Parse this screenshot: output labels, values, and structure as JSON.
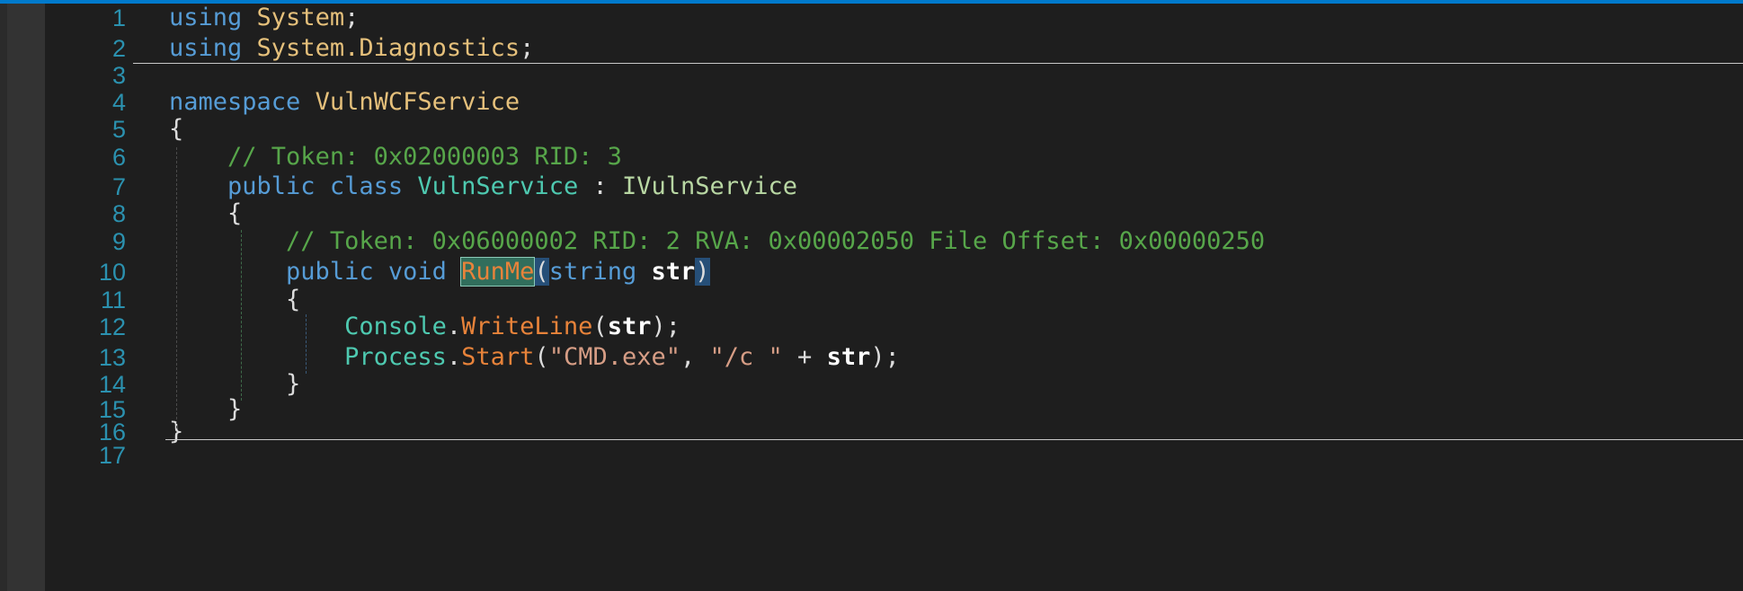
{
  "editor": {
    "colors": {
      "accent_bar": "#007acc",
      "background": "#1e1e1e",
      "line_number": "#2b91af",
      "keyword": "#569cd6",
      "namespace": "#e5c07b",
      "class": "#4ec9b0",
      "interface": "#b8d7a3",
      "comment": "#57a64a",
      "method": "#e8833a",
      "string": "#d69d85"
    },
    "lines": [
      {
        "n": "1",
        "t": [
          "using",
          "System",
          ";"
        ]
      },
      {
        "n": "2",
        "t": [
          "using",
          "System.Diagnostics",
          ";"
        ]
      },
      {
        "n": "3",
        "t": []
      },
      {
        "n": "4",
        "t": [
          "namespace",
          "VulnWCFService"
        ]
      },
      {
        "n": "5",
        "t": [
          "{"
        ]
      },
      {
        "n": "6",
        "t": [
          "// Token: 0x02000003 RID: 3"
        ]
      },
      {
        "n": "7",
        "t": [
          "public",
          "class",
          "VulnService",
          " : ",
          "IVulnService"
        ]
      },
      {
        "n": "8",
        "t": [
          "{"
        ]
      },
      {
        "n": "9",
        "t": [
          "// Token: 0x06000002 RID: 2 RVA: 0x00002050 File Offset: 0x00000250"
        ]
      },
      {
        "n": "10",
        "t": [
          "public",
          "void",
          "RunMe",
          "(",
          "string",
          "str",
          ")"
        ]
      },
      {
        "n": "11",
        "t": [
          "{"
        ]
      },
      {
        "n": "12",
        "t": [
          "Console",
          ".",
          "WriteLine",
          "(",
          "str",
          ");"
        ]
      },
      {
        "n": "13",
        "t": [
          "Process",
          ".",
          "Start",
          "(",
          "\"CMD.exe\"",
          ", ",
          "\"/c \"",
          " + ",
          "str",
          ");"
        ]
      },
      {
        "n": "14",
        "t": [
          "}"
        ]
      },
      {
        "n": "15",
        "t": [
          "}"
        ]
      },
      {
        "n": "16",
        "t": [
          "}"
        ]
      },
      {
        "n": "17",
        "t": []
      }
    ]
  }
}
